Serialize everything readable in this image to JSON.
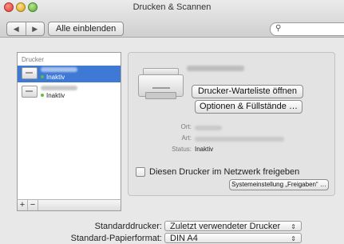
{
  "window": {
    "title": "Drucken & Scannen"
  },
  "toolbar": {
    "back_icon": "◀",
    "forward_icon": "▶",
    "show_all_label": "Alle einblenden",
    "search_icon": "🔍",
    "search_placeholder": ""
  },
  "printer_list": {
    "header": "Drucker",
    "items": [
      {
        "status": "Inaktiv",
        "selected": true
      },
      {
        "status": "Inaktiv",
        "selected": false
      }
    ],
    "add_label": "+",
    "remove_label": "−"
  },
  "detail": {
    "open_queue_label": "Drucker-Warteliste öffnen …",
    "options_label": "Optionen & Füllstände …",
    "location_label": "Ort:",
    "kind_label": "Art:",
    "status_label": "Status:",
    "status_value": "Inaktiv",
    "share_label": "Diesen Drucker im Netzwerk freigeben",
    "share_checked": false,
    "sharing_prefs_label": "Systemeinstellung „Freigaben“ …"
  },
  "defaults": {
    "default_printer_label": "Standarddrucker:",
    "default_printer_value": "Zuletzt verwendeter Drucker",
    "paper_size_label": "Standard-Papierformat:",
    "paper_size_value": "DIN A4",
    "popup_arrows": "⇕"
  },
  "colors": {
    "selection": "#3f79d6",
    "status_dot": "#5fbf3c"
  }
}
